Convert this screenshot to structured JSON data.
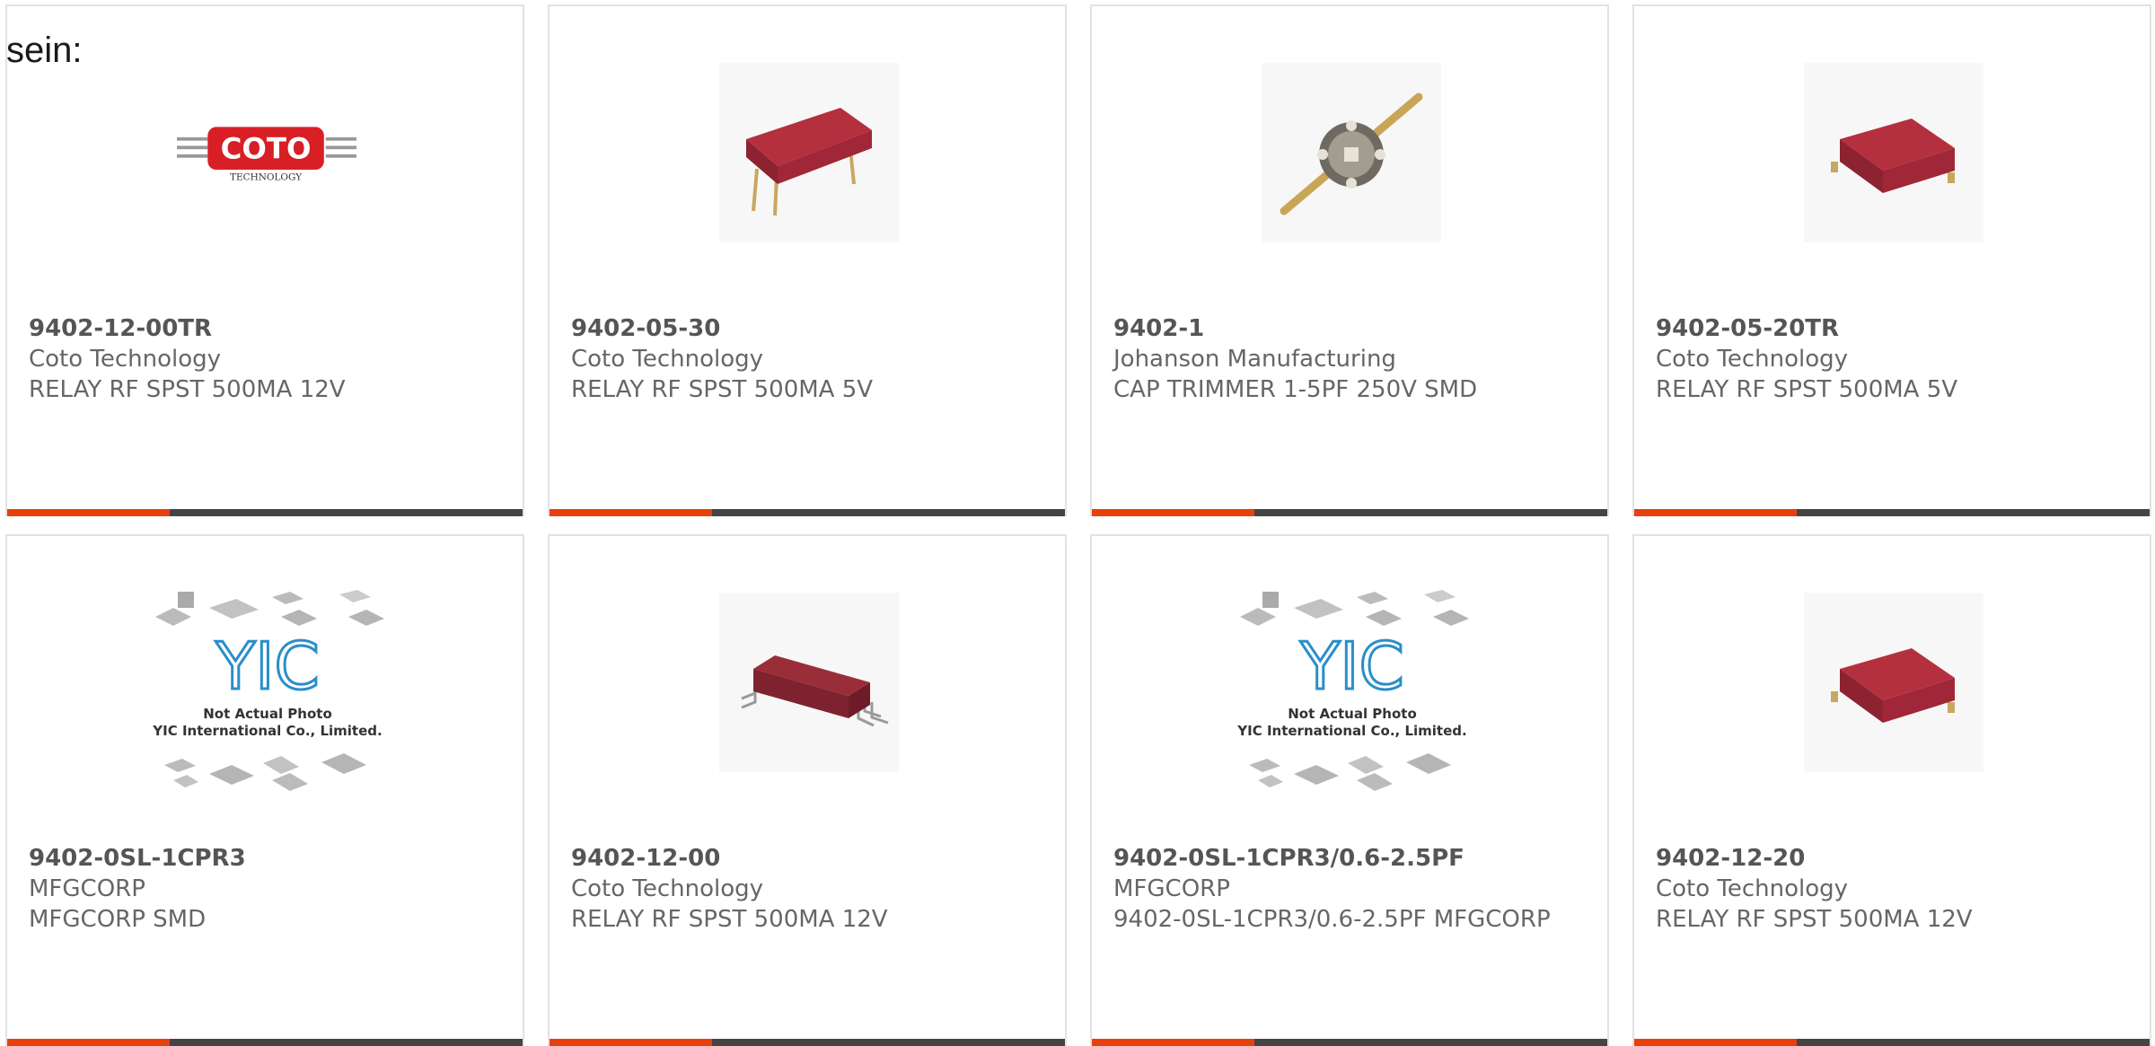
{
  "fragment_text": "sein:",
  "colors": {
    "accent": "#e8400c",
    "bar_dark": "#444444",
    "border": "#e2e2e2"
  },
  "products": [
    {
      "part": "9402-12-00TR",
      "maker": "Coto Technology",
      "desc": "RELAY RF SPST 500MA 12V",
      "image": "coto-logo"
    },
    {
      "part": "9402-05-30",
      "maker": "Coto Technology",
      "desc": "RELAY RF SPST 500MA 5V",
      "image": "relay-thru-hole"
    },
    {
      "part": "9402-1",
      "maker": "Johanson Manufacturing",
      "desc": "CAP TRIMMER 1-5PF 250V SMD",
      "image": "trimmer-cap"
    },
    {
      "part": "9402-05-20TR",
      "maker": "Coto Technology",
      "desc": "RELAY RF SPST 500MA 5V",
      "image": "relay-smd"
    },
    {
      "part": "9402-0SL-1CPR3",
      "maker": "MFGCORP",
      "desc": "MFGCORP SMD",
      "image": "yic-placeholder"
    },
    {
      "part": "9402-12-00",
      "maker": "Coto Technology",
      "desc": "RELAY RF SPST 500MA 12V",
      "image": "relay-smd-gullwing"
    },
    {
      "part": "9402-0SL-1CPR3/0.6-2.5PF",
      "maker": "MFGCORP",
      "desc": "9402-0SL-1CPR3/0.6-2.5PF MFGCORP",
      "image": "yic-placeholder"
    },
    {
      "part": "9402-12-20",
      "maker": "Coto Technology",
      "desc": "RELAY RF SPST 500MA 12V",
      "image": "relay-smd"
    }
  ],
  "logo_text": {
    "coto": "COTO",
    "coto_sub": "TECHNOLOGY",
    "yic": "YIC",
    "yic_line1": "Not Actual Photo",
    "yic_line2": "YIC International Co., Limited."
  }
}
